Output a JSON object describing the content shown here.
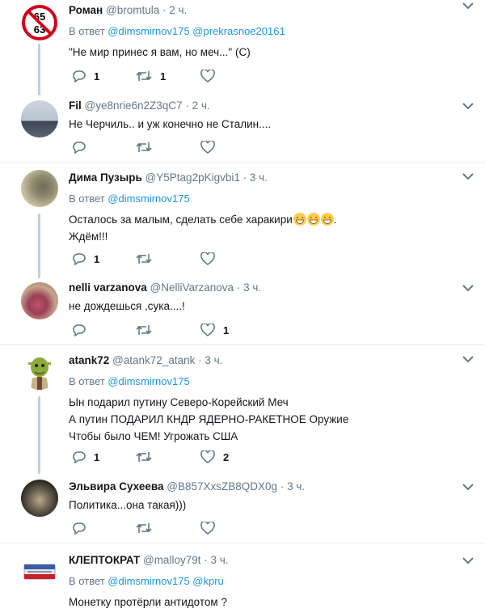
{
  "ui": {
    "reply_prefix": "В ответ",
    "colors": {
      "accent": "#1b95e0",
      "text": "#14171a",
      "secondary": "#657786",
      "divider": "#e6ecf0"
    },
    "icons": [
      "reply-icon",
      "retweet-icon",
      "like-icon",
      "chevron-down-icon"
    ]
  },
  "tweets": [
    {
      "name": "Роман",
      "handle": "@bromtula",
      "time": "2 ч.",
      "reply_to": [
        "@dimsmirnov175",
        "@prekrasnoe20161"
      ],
      "lines": [
        "\"Не мир принес я вам, но меч...\" (С)"
      ],
      "avatar_text": [
        "65",
        "63"
      ],
      "replies": "1",
      "retweets": "1",
      "likes": ""
    },
    {
      "name": "Fil",
      "handle": "@ye8nrie6n2Z3qC7",
      "time": "2 ч.",
      "reply_to": [],
      "lines": [
        "Не Черчиль.. и уж конечно не Сталин...."
      ],
      "replies": "",
      "retweets": "",
      "likes": ""
    },
    {
      "name": "Дима Пузырь",
      "handle": "@Y5Ptag2pKigvbi1",
      "time": "3 ч.",
      "reply_to": [
        "@dimsmirnov175"
      ],
      "lines": [
        "Осталось за малым, сделать себе харакири",
        ".",
        "Ждём!!!"
      ],
      "replies": "1",
      "retweets": "",
      "likes": ""
    },
    {
      "name": "nelli varzanova",
      "handle": "@NelliVarzanova",
      "time": "3 ч.",
      "reply_to": [],
      "lines": [
        "не дождешься ,сука....!"
      ],
      "replies": "",
      "retweets": "",
      "likes": "1"
    },
    {
      "name": "atank72",
      "handle": "@atank72_atank",
      "time": "3 ч.",
      "reply_to": [
        "@dimsmirnov175"
      ],
      "lines": [
        "Ын подарил путину Северо-Корейский Меч",
        "А путин ПОДАРИЛ КНДР ЯДЕРНО-РАКЕТНОЕ Оружие",
        "Чтобы было ЧЕМ! Угрожать США"
      ],
      "replies": "1",
      "retweets": "",
      "likes": "2"
    },
    {
      "name": "Эльвира Сухеева",
      "handle": "@B857XxsZB8QDX0g",
      "time": "3 ч.",
      "reply_to": [],
      "lines": [
        "Политика...она такая)))"
      ],
      "replies": "",
      "retweets": "",
      "likes": ""
    },
    {
      "name": "КЛЕПТОКРАТ",
      "handle": "@malloy79t",
      "time": "3 ч.",
      "reply_to": [
        "@dimsmirnov175",
        "@kpru"
      ],
      "lines": [
        "Монетку протёрли антидотом ?"
      ],
      "replies": "",
      "retweets": "",
      "likes": ""
    }
  ]
}
